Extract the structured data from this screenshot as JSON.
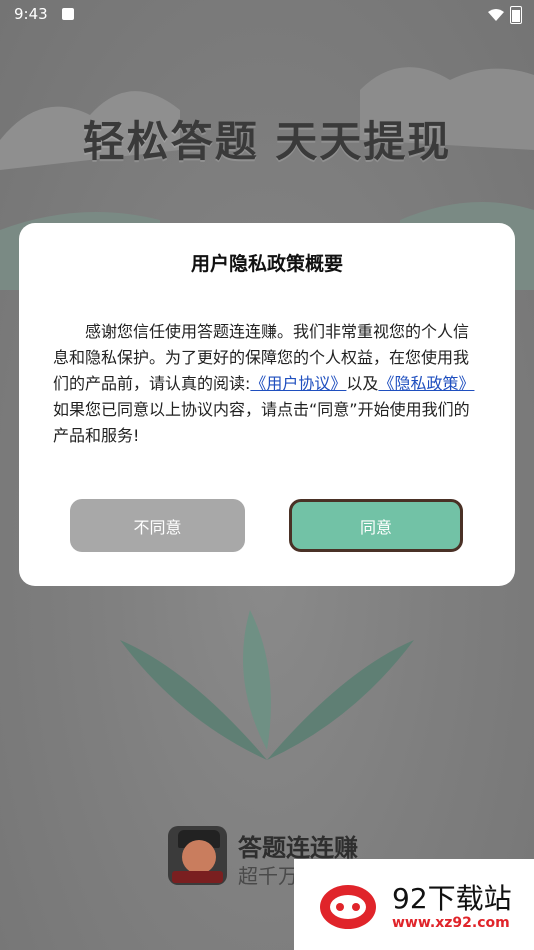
{
  "status_bar": {
    "time": "9:43"
  },
  "hero": {
    "title": "轻松答题 天天提现"
  },
  "dialog": {
    "title": "用户隐私政策概要",
    "body_part1": "感谢您信任使用答题连连赚。我们非常重视您的个人信息和隐私保护。为了更好的保障您的个人权益，在您使用我们的产品前，请认真的阅读:",
    "user_agreement_link": "《用户协议》",
    "body_part2": "以及",
    "privacy_policy_link": "《隐私政策》",
    "body_part3": "如果您已同意以上协议内容，请点击“同意”开始使用我们的产品和服务!",
    "disagree_label": "不同意",
    "agree_label": "同意"
  },
  "app": {
    "name": "答题连连赚",
    "subtitle": "超千万"
  },
  "watermark": {
    "text": "92下载站",
    "url": "www.xz92.com"
  },
  "colors": {
    "agree": "#72c2a6",
    "disagree": "#a8a8a8",
    "link": "#1f4fbf",
    "watermark_red": "#e0242a"
  }
}
